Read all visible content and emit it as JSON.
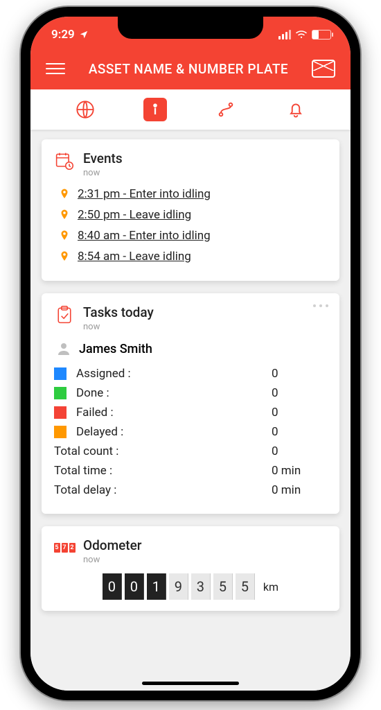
{
  "status": {
    "time": "9:29"
  },
  "header": {
    "title": "ASSET NAME & NUMBER PLATE"
  },
  "events": {
    "title": "Events",
    "sub": "now",
    "items": [
      {
        "text": "2:31 pm - Enter into idling"
      },
      {
        "text": "2:50 pm - Leave idling"
      },
      {
        "text": "8:40 am - Enter into idling"
      },
      {
        "text": "8:54 am - Leave idling"
      }
    ]
  },
  "tasks": {
    "title": "Tasks today",
    "sub": "now",
    "person": "James Smith",
    "rows": [
      {
        "label": "Assigned :",
        "value": "0",
        "swatch": "sw-blue"
      },
      {
        "label": "Done :",
        "value": "0",
        "swatch": "sw-green"
      },
      {
        "label": "Failed :",
        "value": "0",
        "swatch": "sw-red"
      },
      {
        "label": "Delayed :",
        "value": "0",
        "swatch": "sw-orange"
      }
    ],
    "totals": [
      {
        "label": "Total count :",
        "value": "0"
      },
      {
        "label": "Total time :",
        "value": "0 min"
      },
      {
        "label": "Total delay :",
        "value": "0 min"
      }
    ]
  },
  "odometer": {
    "title": "Odometer",
    "sub": "now",
    "icon_digits": [
      "5",
      "7",
      "2"
    ],
    "digits": [
      "0",
      "0",
      "1",
      "9",
      "3",
      "5",
      "5"
    ],
    "unit": "km"
  }
}
